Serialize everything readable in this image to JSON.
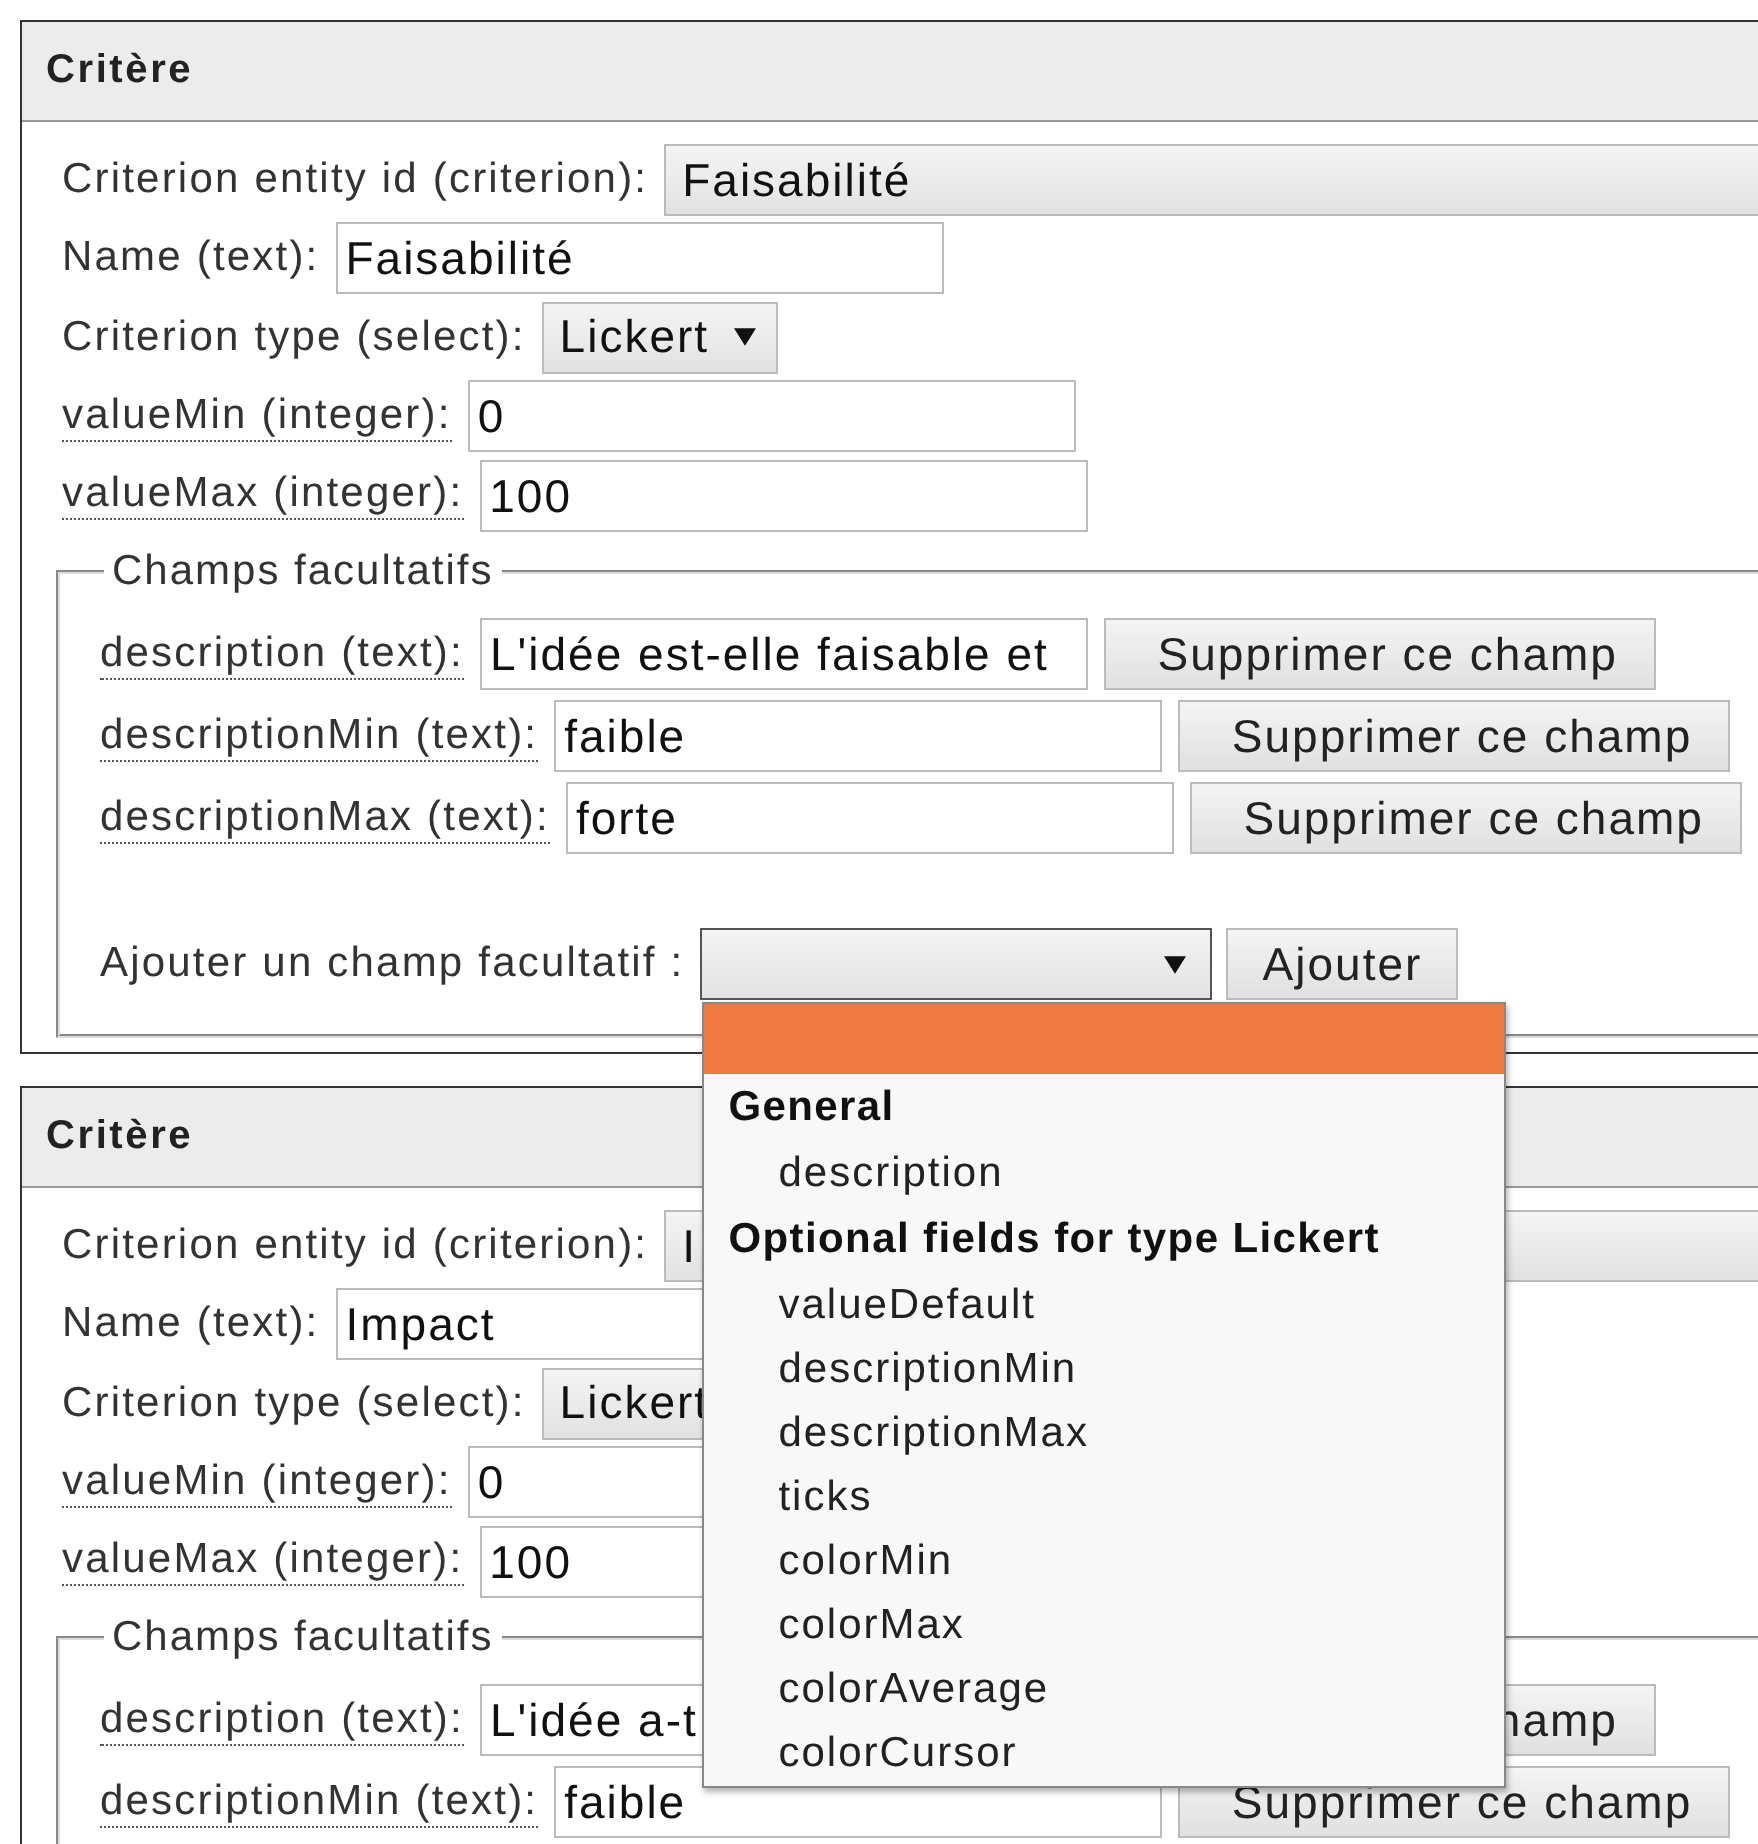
{
  "panels": [
    {
      "title": "Critère",
      "fields": [
        {
          "kind": "combo",
          "label": "Criterion entity id (criterion):",
          "underlined": false,
          "value": "Faisabilité"
        },
        {
          "kind": "text",
          "label": "Name (text):",
          "underlined": false,
          "value": "Faisabilité"
        },
        {
          "kind": "select",
          "label": "Criterion type (select):",
          "underlined": false,
          "value": "Lickert",
          "arrow": true
        },
        {
          "kind": "text",
          "label": "valueMin (integer):",
          "underlined": true,
          "value": "0"
        },
        {
          "kind": "text",
          "label": "valueMax (integer):",
          "underlined": true,
          "value": "100"
        }
      ],
      "optional": {
        "legend": "Champs facultatifs",
        "fields": [
          {
            "label": "description (text):",
            "value": "L'idée est-elle faisable et",
            "button": "Supprimer ce champ"
          },
          {
            "label": "descriptionMin (text):",
            "value": "faible",
            "button": "Supprimer ce champ"
          },
          {
            "label": "descriptionMax (text):",
            "value": "forte",
            "button": "Supprimer ce champ"
          }
        ],
        "add": {
          "label": "Ajouter un champ facultatif :",
          "button": "Ajouter",
          "open": true
        }
      }
    },
    {
      "title": "Critère",
      "fields": [
        {
          "kind": "combo",
          "label": "Criterion entity id (criterion):",
          "underlined": false,
          "value": "I"
        },
        {
          "kind": "text",
          "label": "Name (text):",
          "underlined": false,
          "value": "Impact"
        },
        {
          "kind": "select",
          "label": "Criterion type (select):",
          "underlined": false,
          "value": "Lickert"
        },
        {
          "kind": "text",
          "label": "valueMin (integer):",
          "underlined": true,
          "value": "0"
        },
        {
          "kind": "text",
          "label": "valueMax (integer):",
          "underlined": true,
          "value": "100"
        }
      ],
      "optional": {
        "legend": "Champs facultatifs",
        "fields": [
          {
            "label": "description (text):",
            "value": "L'idée a-t",
            "button": "hamp"
          },
          {
            "label": "descriptionMin (text):",
            "value": "faible",
            "button": "Supprimer ce champ"
          }
        ]
      }
    }
  ],
  "dropdown": {
    "options": [
      {
        "kind": "blank",
        "selected": true
      },
      {
        "kind": "group",
        "label": "General"
      },
      {
        "kind": "option",
        "label": "description",
        "selected": false
      },
      {
        "kind": "group",
        "label": "Optional fields for type Lickert"
      },
      {
        "kind": "option",
        "label": "valueDefault",
        "selected": false
      },
      {
        "kind": "option",
        "label": "descriptionMin",
        "selected": false
      },
      {
        "kind": "option",
        "label": "descriptionMax",
        "selected": false
      },
      {
        "kind": "option",
        "label": "ticks",
        "selected": false
      },
      {
        "kind": "option",
        "label": "colorMin",
        "selected": false
      },
      {
        "kind": "option",
        "label": "colorMax",
        "selected": false
      },
      {
        "kind": "option",
        "label": "colorAverage",
        "selected": false
      },
      {
        "kind": "option",
        "label": "colorCursor",
        "selected": false
      }
    ]
  }
}
